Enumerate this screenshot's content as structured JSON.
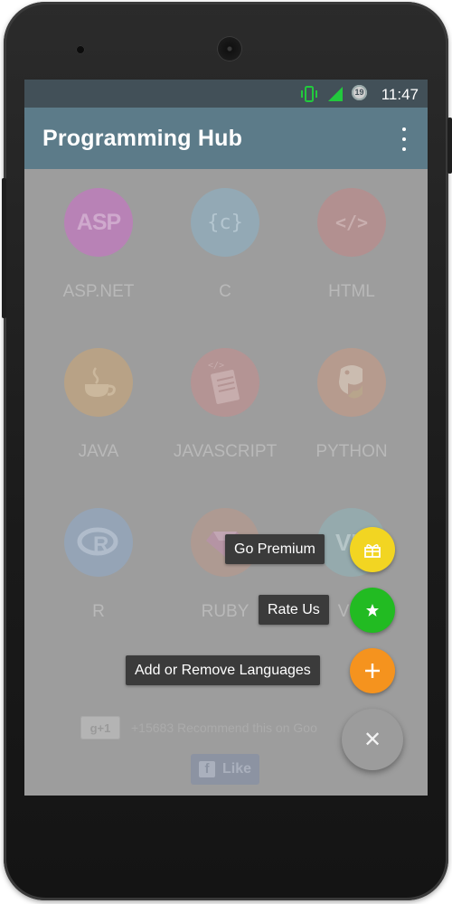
{
  "status_bar": {
    "time": "11:47",
    "notification_badge": "19",
    "icons": [
      "vibrate-icon",
      "signal-icon",
      "notification-badge-icon"
    ]
  },
  "app_bar": {
    "title": "Programming Hub",
    "menu_icon": "overflow-menu-icon"
  },
  "languages": [
    {
      "label": "ASP.NET",
      "icon": "aspnet-icon",
      "icon_text": "ASP",
      "color": "#b882b6"
    },
    {
      "label": "C",
      "icon": "c-icon",
      "icon_text": "{c}",
      "color": "#93a9b5"
    },
    {
      "label": "HTML",
      "icon": "html-icon",
      "icon_text": "</>",
      "color": "#b29090"
    },
    {
      "label": "JAVA",
      "icon": "java-icon",
      "icon_text": "",
      "color": "#b8a286"
    },
    {
      "label": "JAVASCRIPT",
      "icon": "javascript-icon",
      "icon_text": "</>",
      "color": "#b49494"
    },
    {
      "label": "PYTHON",
      "icon": "python-icon",
      "icon_text": "",
      "color": "#b69b8e"
    },
    {
      "label": "R",
      "icon": "r-icon",
      "icon_text": "R",
      "color": "#95a4b6"
    },
    {
      "label": "RUBY",
      "icon": "ruby-icon",
      "icon_text": "",
      "color": "#ae9a92"
    },
    {
      "label": "VB.",
      "icon": "vb-icon",
      "icon_text": "VB",
      "color": "#95aaad"
    }
  ],
  "social": {
    "gplus_label": "g+1",
    "recommend_text": "+15683 Recommend this on Goo",
    "fb_like_label": "Like",
    "fb_icon_letter": "f"
  },
  "fab_menu": {
    "items": [
      {
        "label": "Go Premium",
        "icon": "gift-icon",
        "color": "#f2d522"
      },
      {
        "label": "Rate Us",
        "icon": "star-icon",
        "color": "#22bb22"
      },
      {
        "label": "Add or Remove Languages",
        "icon": "plus-icon",
        "color": "#f5931e"
      }
    ],
    "close_icon": "close-icon",
    "close_glyph": "✕"
  }
}
